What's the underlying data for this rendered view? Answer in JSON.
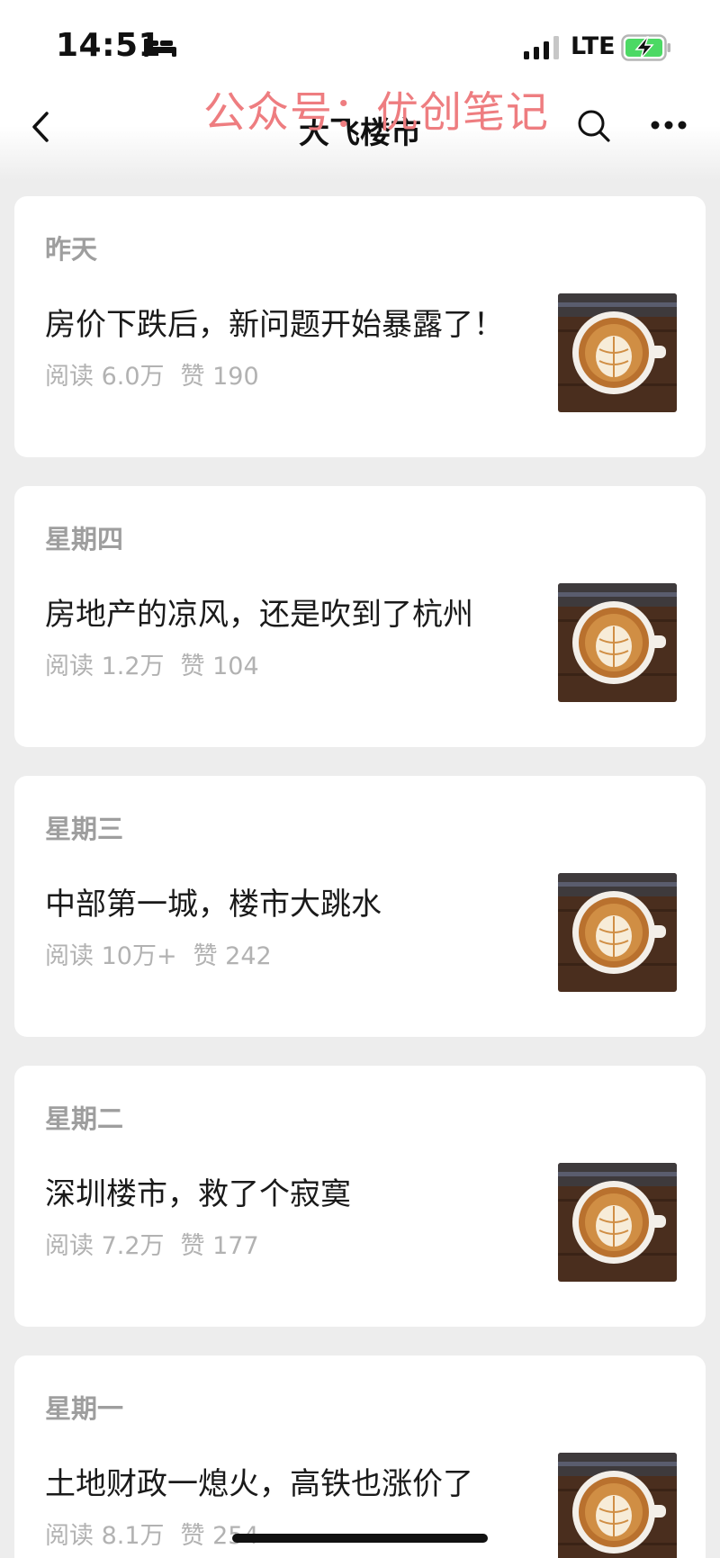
{
  "status_bar": {
    "time": "14:51",
    "network": "LTE"
  },
  "watermark": "公众号：优创笔记",
  "nav": {
    "title": "大飞楼市"
  },
  "articles": [
    {
      "day": "昨天",
      "title": "房价下跌后，新问题开始暴露了！",
      "reads": "阅读 6.0万",
      "likes": "赞 190"
    },
    {
      "day": "星期四",
      "title": "房地产的凉风，还是吹到了杭州",
      "reads": "阅读 1.2万",
      "likes": "赞 104"
    },
    {
      "day": "星期三",
      "title": "中部第一城，楼市大跳水",
      "reads": "阅读 10万+",
      "likes": "赞 242"
    },
    {
      "day": "星期二",
      "title": "深圳楼市，救了个寂寞",
      "reads": "阅读 7.2万",
      "likes": "赞 177"
    },
    {
      "day": "星期一",
      "title": "土地财政一熄火，高铁也涨价了",
      "reads": "阅读 8.1万",
      "likes": "赞 254"
    }
  ],
  "icons": {
    "back": "chevron-left-icon",
    "search": "search-icon",
    "more": "more-icon",
    "thumbnail": "latte-art-coffee-image"
  },
  "colors": {
    "watermark": "#ee7d80",
    "battery": "#4cd964",
    "muted": "#b2b2b2"
  }
}
